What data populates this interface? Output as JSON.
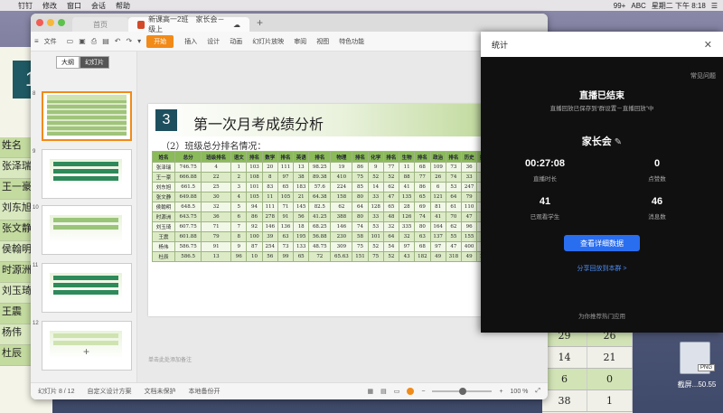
{
  "menubar": {
    "items": [
      "钉钉",
      "修改",
      "窗口",
      "会话",
      "帮助"
    ],
    "status": [
      "99+",
      "ABC",
      "星期二 下午 8:18"
    ]
  },
  "background": {
    "sheet_number": "1",
    "names": [
      "姓名",
      "张泽瑞",
      "王一豪",
      "刘东旭",
      "张文静",
      "侯翰明",
      "时源洲",
      "刘玉琦",
      "王震",
      "杨伟",
      "杜辰"
    ],
    "right_cells": [
      [
        "29",
        "26"
      ],
      [
        "14",
        "21"
      ],
      [
        "6",
        "0"
      ],
      [
        "38",
        "1"
      ]
    ]
  },
  "desktop_file": {
    "label": "截屏...50.55",
    "tag": "PNG"
  },
  "window": {
    "tabs": {
      "home": "首页",
      "doc": "新课高一2班　家长会－级上"
    },
    "toolbar": {
      "file": "文件",
      "start": "开始",
      "items": [
        "插入",
        "设计",
        "动画",
        "幻灯片放映",
        "审阅",
        "视图",
        "特色功能"
      ],
      "collab": "协作"
    },
    "left_tabs": [
      "大纲",
      "幻灯片"
    ],
    "slide_numbers": [
      "8",
      "9",
      "10",
      "11",
      "12"
    ],
    "slide": {
      "num": "3",
      "title": "第一次月考成绩分析",
      "subtitle": "（2）班级总分排名情况：",
      "headers": [
        "姓名",
        "总分",
        "班级排名",
        "语文",
        "排名",
        "数学",
        "排名",
        "英语",
        "排名",
        "物理",
        "排名",
        "化学",
        "排名",
        "生物",
        "排名",
        "政治",
        "排名",
        "历史",
        "排名",
        "地理",
        "排名"
      ],
      "rows": [
        [
          "张泽瑞",
          "746.75",
          "4",
          "1",
          "103",
          "20",
          "111",
          "13",
          "98.25",
          "19",
          "86",
          "9",
          "77",
          "11",
          "68",
          "109",
          "73",
          "36",
          "68",
          "53",
          "71"
        ],
        [
          "王一豪",
          "666.88",
          "22",
          "2",
          "108",
          "8",
          "97",
          "38",
          "89.38",
          "410",
          "75",
          "52",
          "52",
          "88",
          "77",
          "26",
          "74",
          "33",
          "86",
          "39",
          "81"
        ],
        [
          "刘东旭",
          "661.5",
          "25",
          "3",
          "101",
          "83",
          "65",
          "183",
          "57.6",
          "224",
          "85",
          "14",
          "62",
          "41",
          "86",
          "6",
          "53",
          "247",
          "60",
          "92",
          "76"
        ],
        [
          "张文静",
          "649.88",
          "30",
          "4",
          "105",
          "11",
          "105",
          "21",
          "64.38",
          "158",
          "80",
          "33",
          "47",
          "135",
          "65",
          "121",
          "64",
          "79",
          "49",
          "249",
          "72"
        ],
        [
          "侯翰明",
          "648.5",
          "32",
          "5",
          "94",
          "111",
          "71",
          "145",
          "82.5",
          "62",
          "64",
          "128",
          "65",
          "28",
          "69",
          "81",
          "61",
          "110",
          "67",
          "27",
          "77"
        ],
        [
          "时源洲",
          "643.75",
          "36",
          "6",
          "86",
          "278",
          "91",
          "56",
          "41.25",
          "388",
          "80",
          "33",
          "48",
          "126",
          "74",
          "41",
          "70",
          "47",
          "89",
          "19",
          "82"
        ],
        [
          "刘玉琦",
          "607.75",
          "71",
          "7",
          "92",
          "146",
          "136",
          "18",
          "68.25",
          "146",
          "74",
          "53",
          "32",
          "335",
          "80",
          "164",
          "62",
          "96",
          "58",
          "122",
          "78"
        ],
        [
          "王震",
          "601.88",
          "79",
          "8",
          "100",
          "39",
          "63",
          "195",
          "56.88",
          "230",
          "58",
          "101",
          "64",
          "32",
          "63",
          "137",
          "55",
          "155",
          "56",
          "151",
          "70"
        ],
        [
          "杨伟",
          "586.75",
          "91",
          "9",
          "87",
          "254",
          "73",
          "133",
          "48.75",
          "309",
          "75",
          "52",
          "54",
          "97",
          "68",
          "97",
          "47",
          "400",
          "65",
          "87",
          "73"
        ],
        [
          "杜辰",
          "586.5",
          "13",
          "96",
          "10",
          "56",
          "99",
          "65",
          "72",
          "65.63",
          "151",
          "75",
          "52",
          "43",
          "182",
          "49",
          "318",
          "49",
          "267",
          "62",
          "83"
        ]
      ]
    },
    "notes_placeholder": "单击此处添加备注",
    "status": {
      "slide_count": "幻灯片 8 / 12",
      "theme": "自定义设计方案",
      "protect": "文档未保护",
      "backup": "本地备份开",
      "zoom": "100 %"
    }
  },
  "stats_panel": {
    "title": "统计",
    "help": "常见问题",
    "ended": "直播已结束",
    "saved_note": "直播回放已保存到“群设置－直播回放”中",
    "meeting_name": "家长会",
    "duration": {
      "value": "00:27:08",
      "label": "直播时长"
    },
    "likes": {
      "value": "0",
      "label": "点赞数"
    },
    "viewers": {
      "value": "41",
      "label": "已观看学生"
    },
    "messages": {
      "value": "46",
      "label": "消息数"
    },
    "detail_button": "查看详细数据",
    "share_link": "分享回放到本群 >",
    "recommend": "为你推荐热门应用",
    "accent": "#2a6ef0"
  }
}
